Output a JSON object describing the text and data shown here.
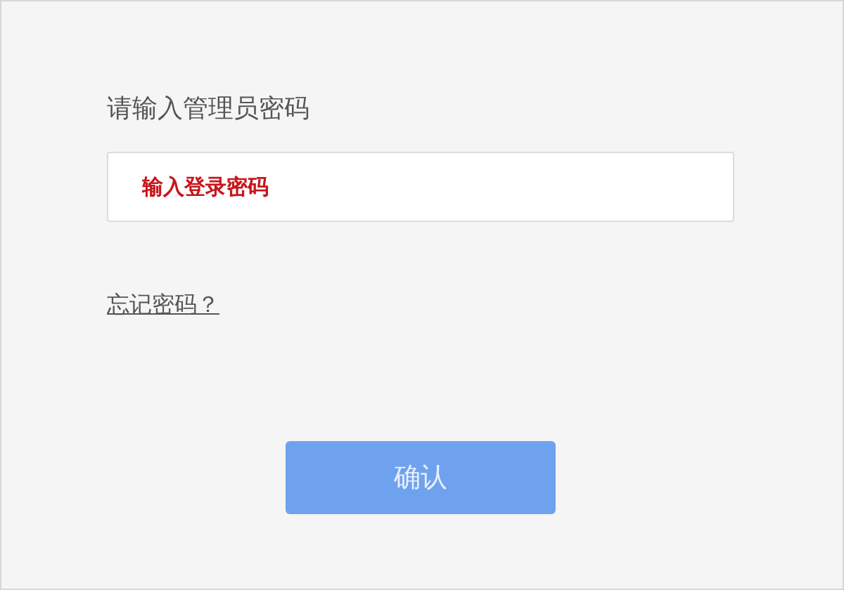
{
  "login": {
    "heading": "请输入管理员密码",
    "password_field": {
      "placeholder": "输入登录密码"
    },
    "forgot_link": "忘记密码？",
    "confirm_button": "确认"
  }
}
